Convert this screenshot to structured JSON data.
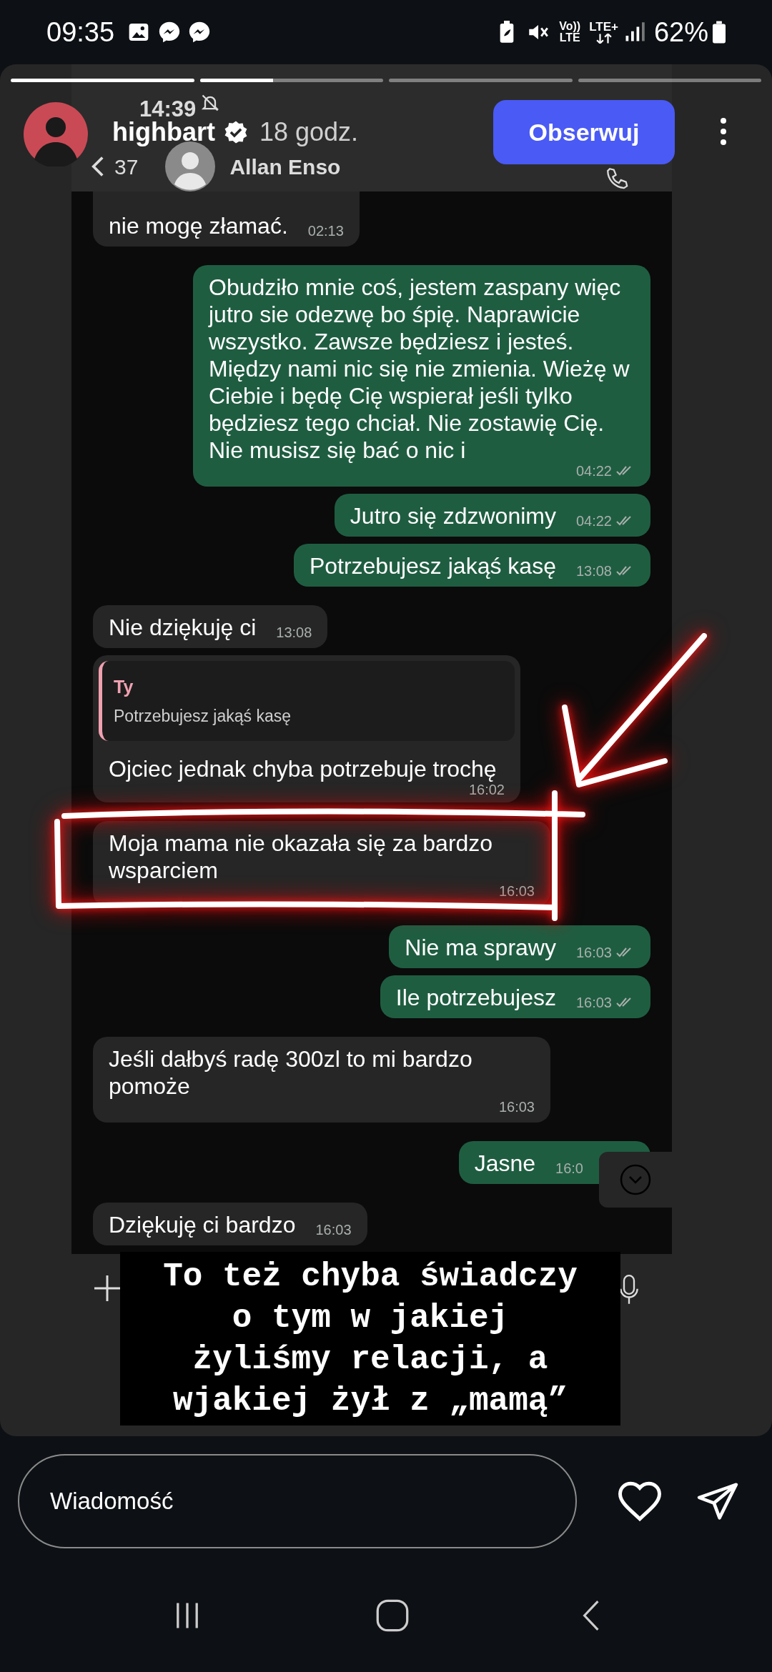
{
  "status_bar": {
    "time": "09:35",
    "network_labels": [
      "Vo))",
      "LTE",
      "LTE+"
    ],
    "battery": "62%"
  },
  "story": {
    "progress": [
      {
        "viewed": true
      },
      {
        "viewed": false,
        "level": 0.4
      },
      {
        "viewed": false
      },
      {
        "viewed": false
      }
    ],
    "author": "highbart",
    "verified": true,
    "age": "18 godz.",
    "follow_button": "Obserwuj"
  },
  "screenshot": {
    "status_time": "14:39",
    "chat_header": {
      "back_count": "37",
      "contact": "Allan Enso"
    },
    "messages": [
      {
        "kind": "received",
        "text": "nie mogę złamać.",
        "time": "02:13",
        "cut_top": true
      },
      {
        "kind": "sent",
        "text": "Obudziło mnie coś, jestem zaspany więc jutro sie odezwę bo śpię. Naprawicie wszystko. Zawsze będziesz i jesteś. Między nami nic się nie zmienia. Wieżę w Ciebie i będę Cię wspierał jeśli tylko będziesz tego chciał. Nie zostawię Cię. Nie musisz się bać o nic i",
        "time": "04:22",
        "ticks": true
      },
      {
        "kind": "sent",
        "text": "Jutro się zdzwonimy",
        "time": "04:22",
        "ticks": true
      },
      {
        "kind": "sent",
        "text": "Potrzebujesz jakąś kasę",
        "time": "13:08",
        "ticks": true
      },
      {
        "kind": "received",
        "text": "Nie dziękuję ci",
        "time": "13:08",
        "cut_top": false
      },
      {
        "kind": "reply",
        "quote_author": "Ty",
        "quote_text": "Potrzebujesz jakąś kasę",
        "text": "Ojciec jednak chyba potrzebuje trochę",
        "time": "16:02"
      },
      {
        "kind": "received",
        "text": "Moja mama nie okazała się za bardzo wsparciem",
        "time": "16:03",
        "cut_top": false
      },
      {
        "kind": "sent",
        "text": "Nie ma sprawy",
        "time": "16:03",
        "ticks": true
      },
      {
        "kind": "sent",
        "text": "Ile potrzebujesz",
        "time": "16:03",
        "ticks": true
      },
      {
        "kind": "received",
        "text": "Jeśli dałbyś radę 300zl to mi bardzo pomoże",
        "time": "16:03",
        "cut_top": false
      },
      {
        "kind": "sent",
        "text": "Jasne",
        "time": "16:0",
        "ticks": false
      },
      {
        "kind": "received",
        "text": "Dziękuję ci bardzo",
        "time": "16:03",
        "cut_top": false
      }
    ]
  },
  "caption": "To też chyba świadczy\no tym w jakiej\nżyliśmy relacji, a\nwjakiej żył z „mamą”",
  "reply_bar": {
    "placeholder": "Wiadomość"
  }
}
